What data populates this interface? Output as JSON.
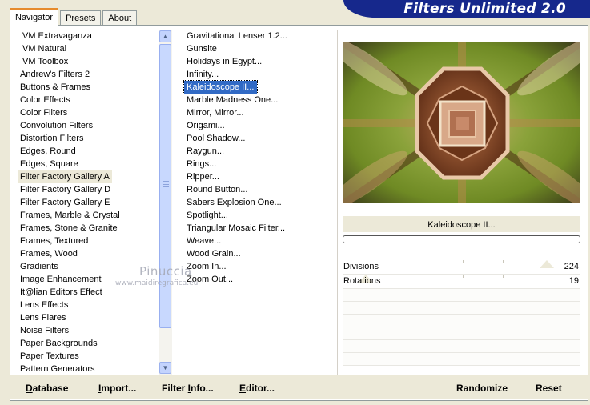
{
  "tabs": [
    "Navigator",
    "Presets",
    "About"
  ],
  "banner": "Filters Unlimited 2.0",
  "categories": [
    {
      "label": "VM Extravaganza",
      "indent": true
    },
    {
      "label": "VM Natural",
      "indent": true
    },
    {
      "label": "VM Toolbox",
      "indent": true
    },
    {
      "label": "Andrew's Filters 2"
    },
    {
      "label": "Buttons & Frames"
    },
    {
      "label": "Color Effects"
    },
    {
      "label": "Color Filters"
    },
    {
      "label": "Convolution Filters"
    },
    {
      "label": "Distortion Filters"
    },
    {
      "label": "Edges, Round"
    },
    {
      "label": "Edges, Square"
    },
    {
      "label": "Filter Factory Gallery A",
      "selected": true
    },
    {
      "label": "Filter Factory Gallery D"
    },
    {
      "label": "Filter Factory Gallery E"
    },
    {
      "label": "Frames, Marble & Crystal"
    },
    {
      "label": "Frames, Stone & Granite"
    },
    {
      "label": "Frames, Textured"
    },
    {
      "label": "Frames, Wood"
    },
    {
      "label": "Gradients"
    },
    {
      "label": "Image Enhancement"
    },
    {
      "label": "It@lian Editors Effect"
    },
    {
      "label": "Lens Effects"
    },
    {
      "label": "Lens Flares"
    },
    {
      "label": "Noise Filters"
    },
    {
      "label": "Paper Backgrounds"
    },
    {
      "label": "Paper Textures"
    },
    {
      "label": "Pattern Generators"
    }
  ],
  "filters": [
    {
      "label": "Gravitational Lenser 1.2..."
    },
    {
      "label": "Gunsite"
    },
    {
      "label": "Holidays in Egypt..."
    },
    {
      "label": "Infinity..."
    },
    {
      "label": "Kaleidoscope II...",
      "selected": true
    },
    {
      "label": "Marble Madness One..."
    },
    {
      "label": "Mirror, Mirror..."
    },
    {
      "label": "Origami..."
    },
    {
      "label": "Pool Shadow..."
    },
    {
      "label": "Raygun..."
    },
    {
      "label": "Rings..."
    },
    {
      "label": "Ripper..."
    },
    {
      "label": "Round Button..."
    },
    {
      "label": "Sabers Explosion One..."
    },
    {
      "label": "Spotlight..."
    },
    {
      "label": "Triangular Mosaic Filter..."
    },
    {
      "label": "Weave..."
    },
    {
      "label": "Wood Grain..."
    },
    {
      "label": "Zoom In..."
    },
    {
      "label": "Zoom Out..."
    }
  ],
  "current_filter": "Kaleidoscope II...",
  "params": [
    {
      "label": "Divisions",
      "value": "224",
      "level": 0.88
    },
    {
      "label": "Rotations",
      "value": "19",
      "level": 0.07
    }
  ],
  "buttons": {
    "database": {
      "key": "D",
      "rest": "atabase"
    },
    "import": {
      "key": "I",
      "rest": "mport..."
    },
    "filter_info": {
      "pre": "Filter ",
      "key": "I",
      "rest": "nfo..."
    },
    "editor": {
      "key": "E",
      "rest": "ditor..."
    },
    "randomize": "Randomize",
    "reset": "Reset"
  },
  "watermark": {
    "name": "Pinuccia",
    "url": "www.maidiregrafica.eu"
  },
  "colors": {
    "selection": "#316ac5",
    "banner": "#16288c",
    "panel": "#ece9d8"
  }
}
